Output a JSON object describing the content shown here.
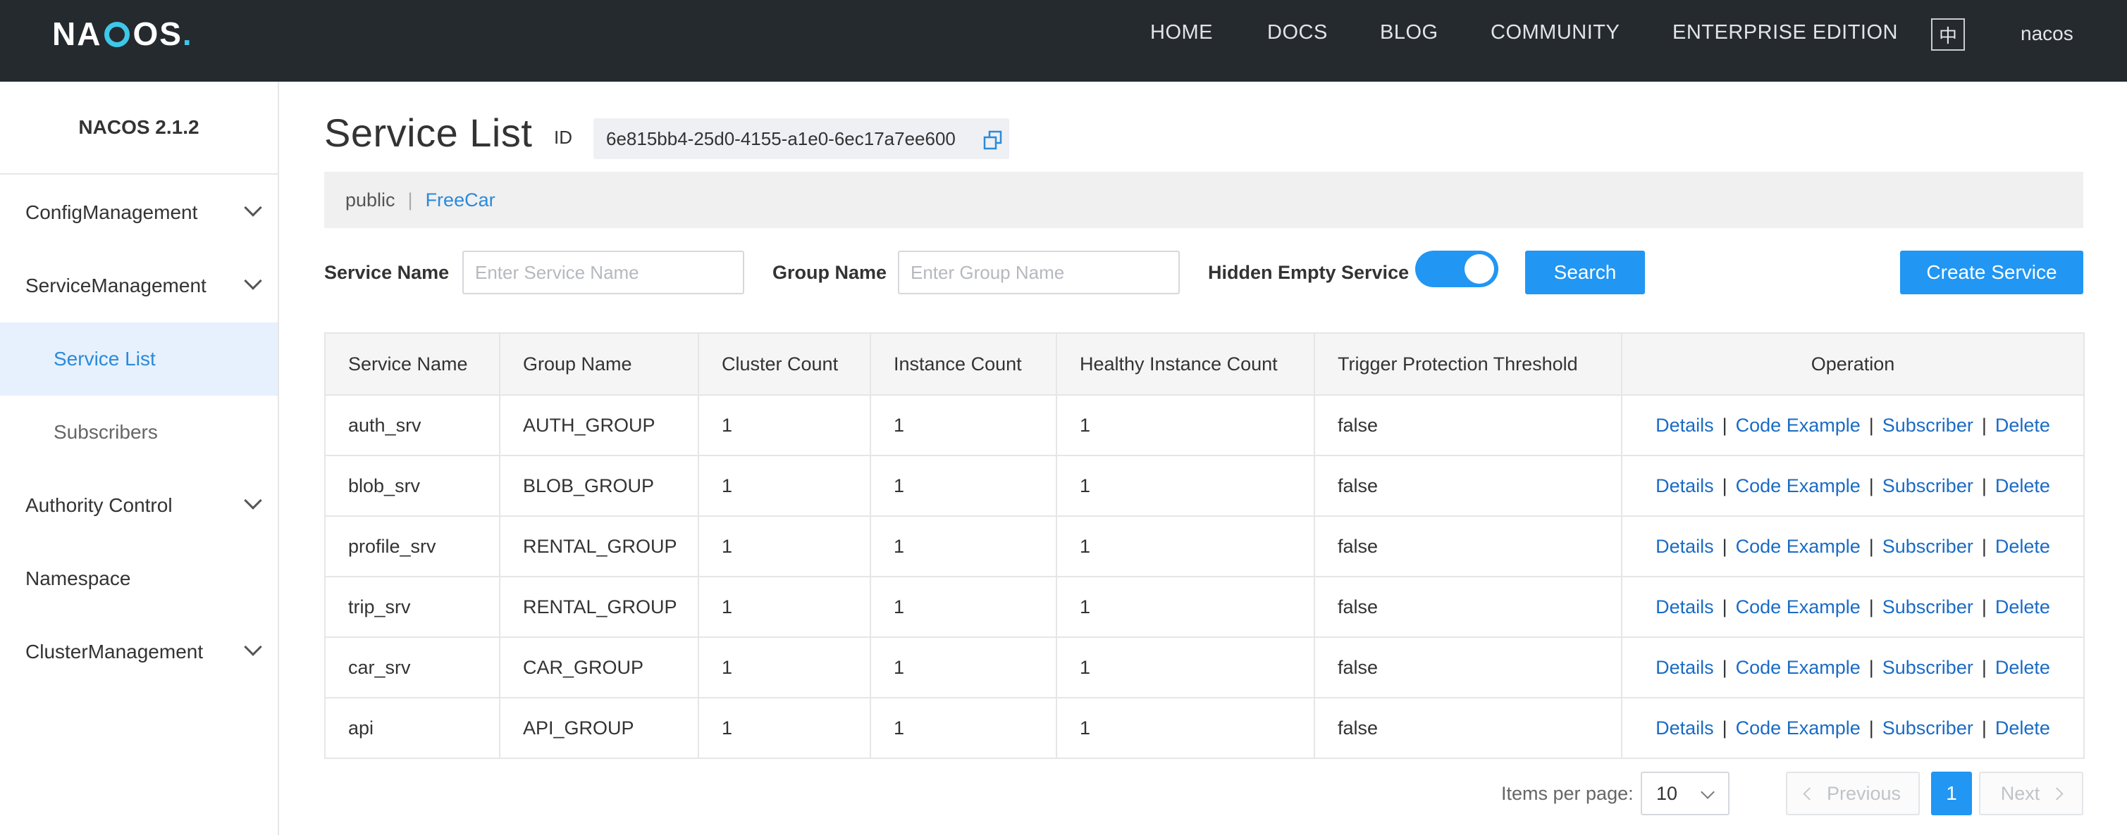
{
  "header": {
    "logo": {
      "before": "NA",
      "after": "OS",
      "dot": "."
    },
    "nav": [
      "HOME",
      "DOCS",
      "BLOG",
      "COMMUNITY",
      "ENTERPRISE EDITION"
    ],
    "lang": "中",
    "user": "nacos"
  },
  "sidebar": {
    "version": "NACOS 2.1.2",
    "items": [
      {
        "label": "ConfigManagement"
      },
      {
        "label": "ServiceManagement"
      },
      {
        "label": "Service List"
      },
      {
        "label": "Subscribers"
      },
      {
        "label": "Authority Control"
      },
      {
        "label": "Namespace"
      },
      {
        "label": "ClusterManagement"
      }
    ]
  },
  "main": {
    "title": "Service List",
    "id_label": "ID",
    "namespace_id": "6e815bb4-25d0-4155-a1e0-6ec17a7ee600",
    "namespaces": [
      "public",
      "FreeCar"
    ],
    "ns_separator": "|",
    "filters": {
      "service_name_label": "Service Name",
      "service_name_placeholder": "Enter Service Name",
      "group_name_label": "Group Name",
      "group_name_placeholder": "Enter Group Name",
      "hidden_empty_label": "Hidden Empty Service",
      "hidden_empty_on": true,
      "search_label": "Search",
      "create_label": "Create Service"
    },
    "table": {
      "columns": [
        "Service Name",
        "Group Name",
        "Cluster Count",
        "Instance Count",
        "Healthy Instance Count",
        "Trigger Protection Threshold",
        "Operation"
      ],
      "operations": [
        "Details",
        "Code Example",
        "Subscriber",
        "Delete"
      ],
      "op_separator": "|",
      "rows": [
        [
          "auth_srv",
          "AUTH_GROUP",
          "1",
          "1",
          "1",
          "false"
        ],
        [
          "blob_srv",
          "BLOB_GROUP",
          "1",
          "1",
          "1",
          "false"
        ],
        [
          "profile_srv",
          "RENTAL_GROUP",
          "1",
          "1",
          "1",
          "false"
        ],
        [
          "trip_srv",
          "RENTAL_GROUP",
          "1",
          "1",
          "1",
          "false"
        ],
        [
          "car_srv",
          "CAR_GROUP",
          "1",
          "1",
          "1",
          "false"
        ],
        [
          "api",
          "API_GROUP",
          "1",
          "1",
          "1",
          "false"
        ]
      ]
    },
    "pagination": {
      "items_per_page_label": "Items per page:",
      "items_per_page": "10",
      "previous": "Previous",
      "current_page": "1",
      "next": "Next"
    }
  },
  "colors": {
    "header_bg": "#252a2f",
    "accent": "#2196f3",
    "link": "#1a6bc6",
    "active_bg": "#e6f1fd"
  }
}
